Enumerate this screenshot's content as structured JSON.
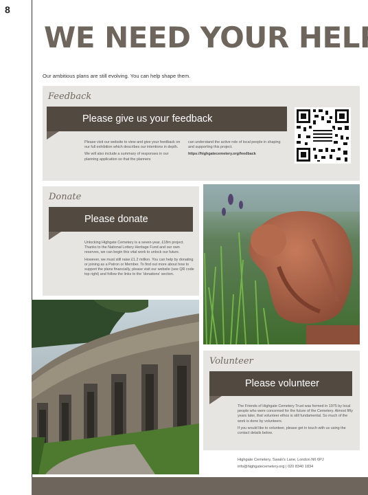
{
  "page_number": "8",
  "heading": "WE NEED YOUR HELP",
  "intro": "Our ambitious plans are still evolving. You can help shape them.",
  "feedback": {
    "section_title": "Feedback",
    "ribbon": "Please give us your feedback",
    "col1_p1": "Please visit our website to view and give your feedback on our full exhibition which describes our intentions in depth.",
    "col1_p2": "We will also include a summary of responses in our planning application so that the planners",
    "col2_p1": "can understand the active role of local people in shaping and supporting this project.",
    "url": "https://highgatecemetery.org/feedback"
  },
  "donate": {
    "section_title": "Donate",
    "ribbon": "Please donate",
    "p1": "Unlocking Highgate Cemetery is a seven-year, £18m project. Thanks to the National Lottery Heritage Fund and our own reserves, we can begin this vital work to unlock our future.",
    "p2": "However, we must still raise £1.2 million. You can help by donating or joining as a Patron or Member. To find out more about how to support the plans financially, please visit our website (see QR code top right) and follow the links to the 'donations' section."
  },
  "volunteer": {
    "section_title": "Volunteer",
    "ribbon": "Please volunteer",
    "p1": "The Friends of Highgate Cemetery Trust was formed in 1975 by local people who were concerned for the future of the Cemetery. Almost fifty years later, that volunteer ethos is still fundamental. So much of the work is done by volunteers.",
    "p2": "If you would like to volunteer, please get in touch with us using the contact details below."
  },
  "contact": {
    "address": "Highgate Cemetery, Swain's Lane, London N6 6PJ",
    "email_phone": "info@highgatecemetery.org | 020 8340 1834"
  },
  "colors": {
    "brand_taupe": "#6e665c",
    "ribbon_dark": "#524a41",
    "panel_grey": "#e7e5e1"
  }
}
